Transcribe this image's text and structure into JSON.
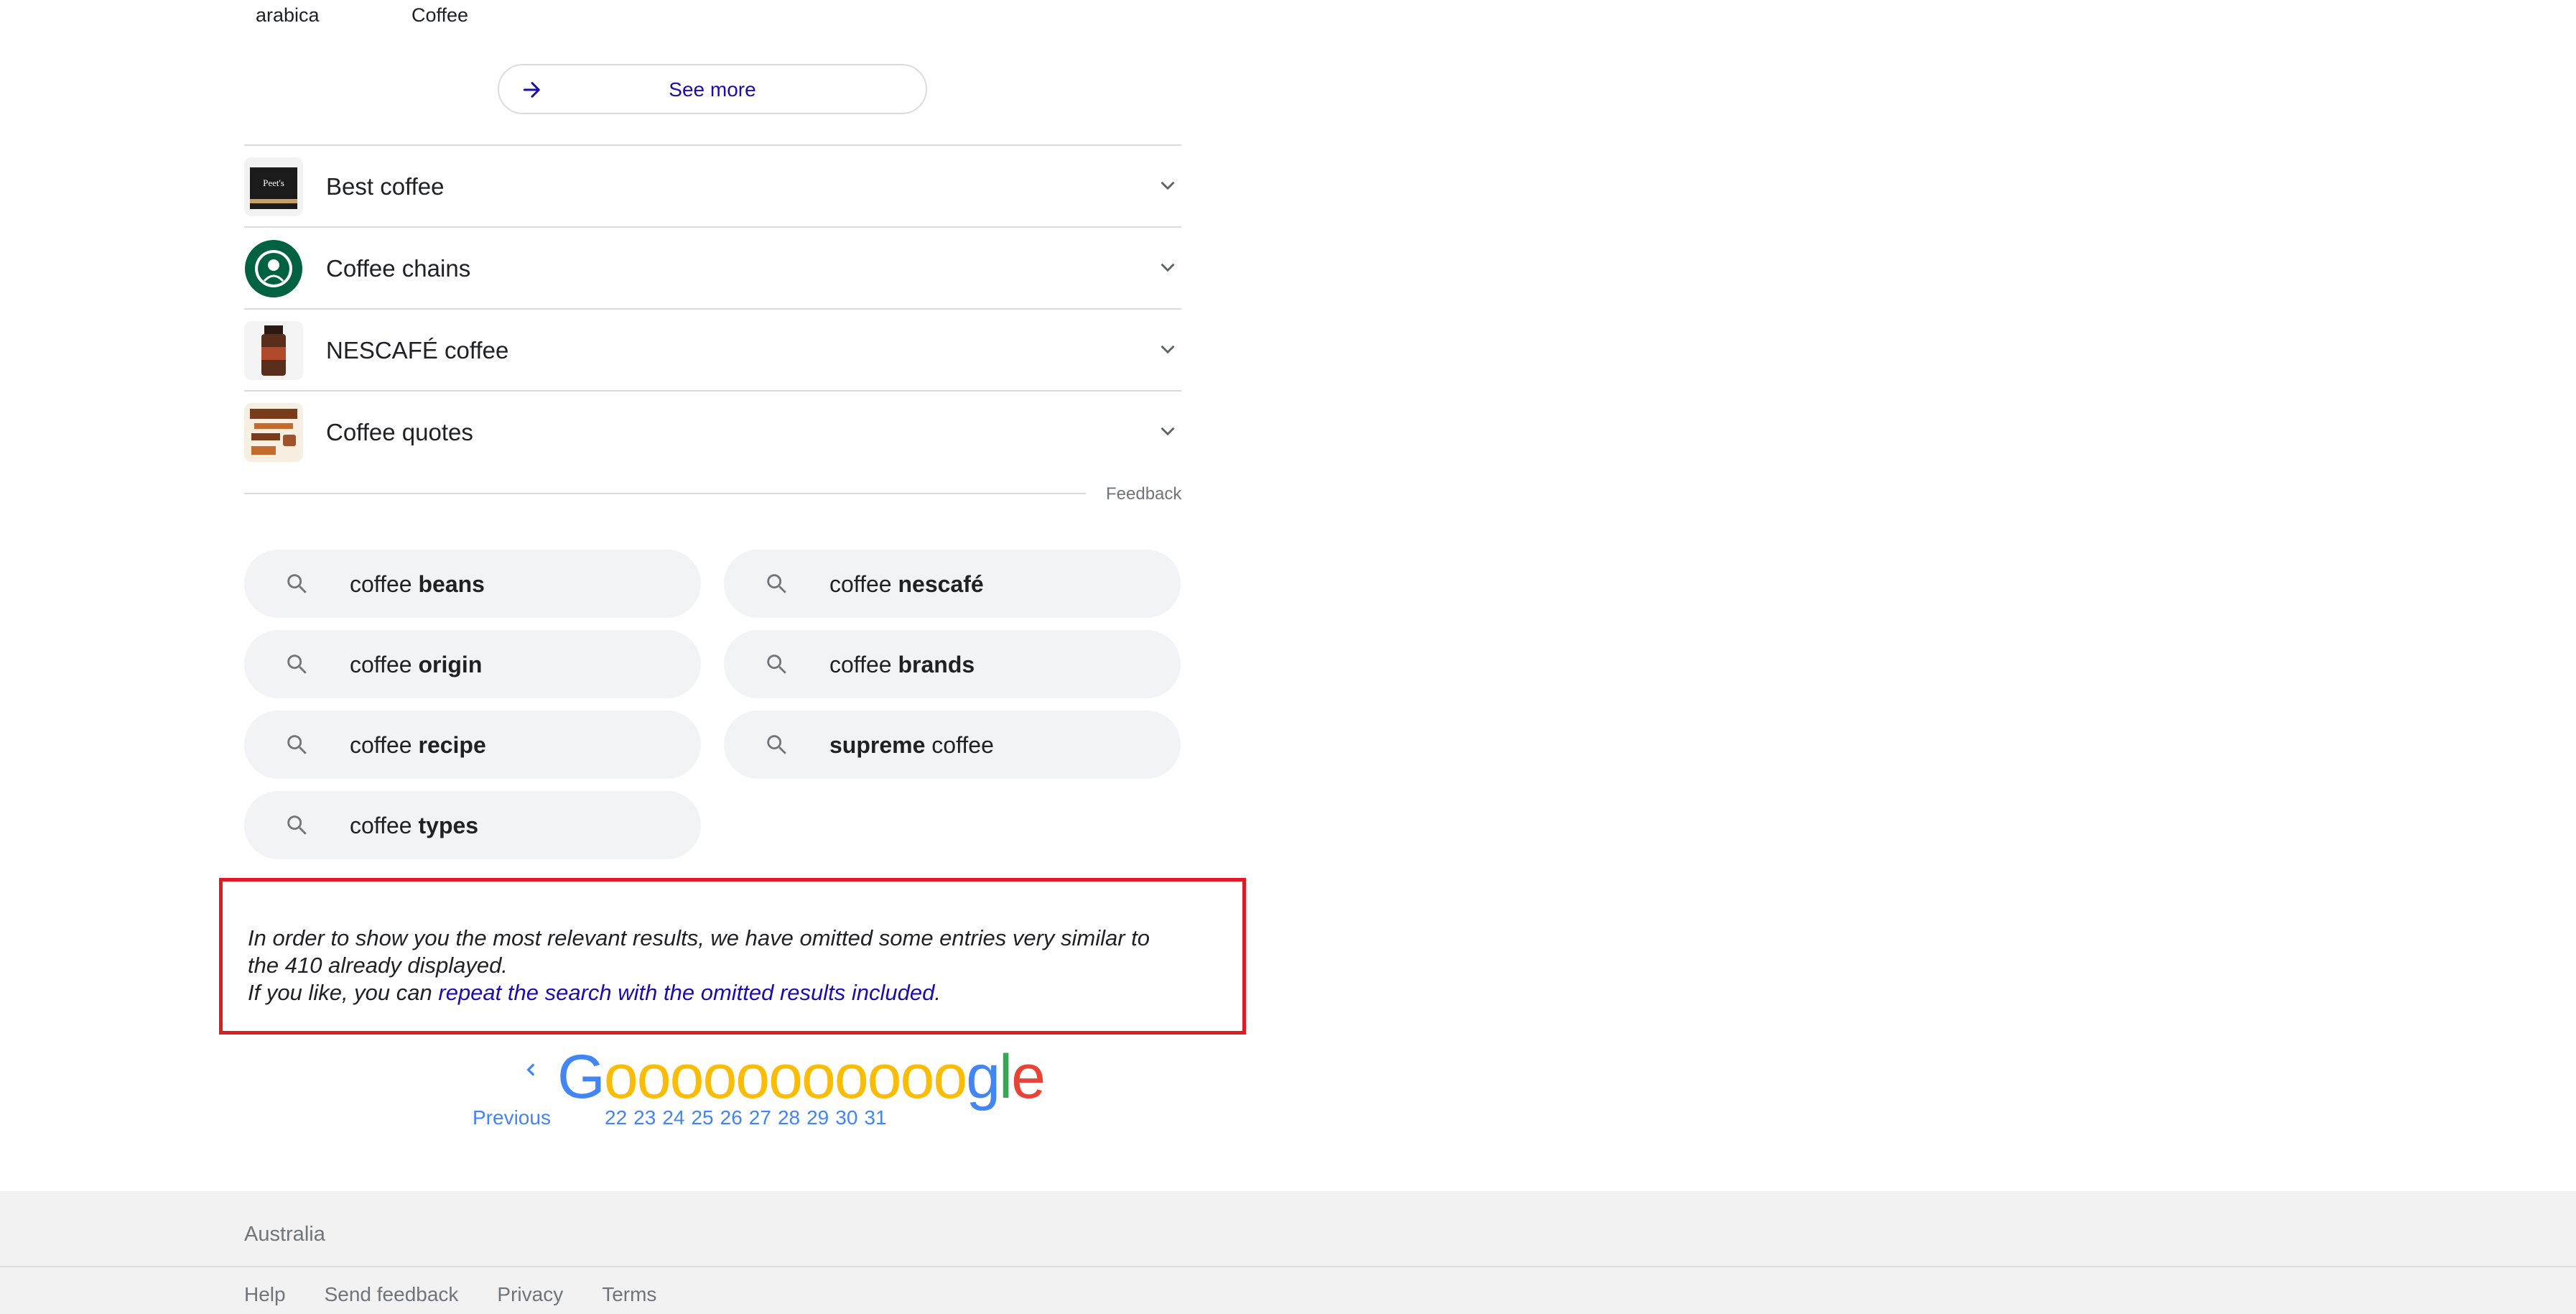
{
  "top_labels": [
    "arabica",
    "Coffee"
  ],
  "see_more": {
    "label": "See more",
    "icon": "arrow-right-icon"
  },
  "accordion": [
    {
      "label": "Best coffee",
      "thumb": "peets-coffee-box-thumbnail"
    },
    {
      "label": "Coffee chains",
      "thumb": "starbucks-logo-thumbnail"
    },
    {
      "label": "NESCAFÉ coffee",
      "thumb": "nescafe-jar-thumbnail"
    },
    {
      "label": "Coffee quotes",
      "thumb": "coffee-quote-poster-thumbnail"
    }
  ],
  "feedback_label": "Feedback",
  "related_searches": [
    {
      "prefix": "coffee ",
      "bold": "beans",
      "suffix": ""
    },
    {
      "prefix": "coffee ",
      "bold": "nescafé",
      "suffix": ""
    },
    {
      "prefix": "coffee ",
      "bold": "origin",
      "suffix": ""
    },
    {
      "prefix": "coffee ",
      "bold": "brands",
      "suffix": ""
    },
    {
      "prefix": "coffee ",
      "bold": "recipe",
      "suffix": ""
    },
    {
      "prefix": "",
      "bold": "supreme",
      "suffix": " coffee"
    },
    {
      "prefix": "coffee ",
      "bold": "types",
      "suffix": ""
    }
  ],
  "notice": {
    "line1": "In order to show you the most relevant results, we have omitted some entries very similar to",
    "line2": "the 410 already displayed.",
    "line3_prefix": "If you like, you can ",
    "line3_link": "repeat the search with the omitted results included",
    "line3_suffix": "."
  },
  "pagination": {
    "previous_label": "Previous",
    "logo_letters": [
      "G",
      "o",
      "o",
      "o",
      "o",
      "o",
      "o",
      "o",
      "o",
      "o",
      "o",
      "o",
      "g",
      "l",
      "e"
    ],
    "pages": [
      "22",
      "23",
      "24",
      "25",
      "26",
      "27",
      "28",
      "29",
      "30",
      "31"
    ]
  },
  "footer": {
    "country": "Australia",
    "links": [
      "Help",
      "Send feedback",
      "Privacy",
      "Terms"
    ]
  },
  "colors": {
    "link": "#1a0dab",
    "pagination": "#4285f4",
    "notice_border": "#e01b22",
    "google_blue": "#4285f4",
    "google_red": "#ea4335",
    "google_yellow": "#fbbc05",
    "google_green": "#34a853"
  }
}
